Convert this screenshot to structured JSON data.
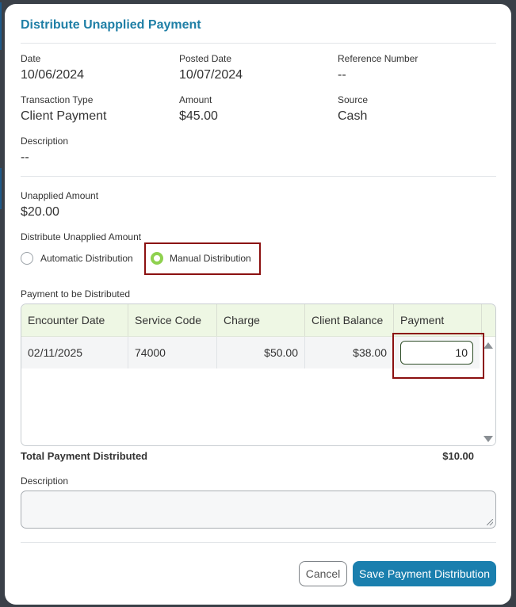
{
  "dialog": {
    "title": "Distribute Unapplied Payment"
  },
  "details": {
    "date_label": "Date",
    "date_value": "10/06/2024",
    "posted_date_label": "Posted Date",
    "posted_date_value": "10/07/2024",
    "reference_label": "Reference Number",
    "reference_value": "--",
    "transaction_type_label": "Transaction Type",
    "transaction_type_value": "Client Payment",
    "amount_label": "Amount",
    "amount_value": "$45.00",
    "source_label": "Source",
    "source_value": "Cash",
    "description_label": "Description",
    "description_value": "--"
  },
  "unapplied": {
    "label": "Unapplied Amount",
    "value": "$20.00",
    "distribute_label": "Distribute Unapplied Amount",
    "options": [
      {
        "label": "Automatic Distribution",
        "selected": false
      },
      {
        "label": "Manual Distribution",
        "selected": true
      }
    ]
  },
  "grid": {
    "caption": "Payment to be Distributed",
    "columns": [
      "Encounter Date",
      "Service Code",
      "Charge",
      "Client Balance",
      "Payment"
    ],
    "rows": [
      {
        "encounter_date": "02/11/2025",
        "service_code": "74000",
        "charge": "$50.00",
        "client_balance": "$38.00",
        "payment": "10"
      }
    ],
    "header_color": "#eef7e4"
  },
  "totals": {
    "label": "Total Payment Distributed",
    "value": "$10.00"
  },
  "description": {
    "label": "Description",
    "value": ""
  },
  "actions": {
    "cancel_label": "Cancel",
    "save_label": "Save Payment Distribution"
  },
  "colors": {
    "accent": "#1a7fae",
    "title": "#1f7fa6",
    "radio_selected": "#8fd14f",
    "highlight": "#8b1010"
  }
}
